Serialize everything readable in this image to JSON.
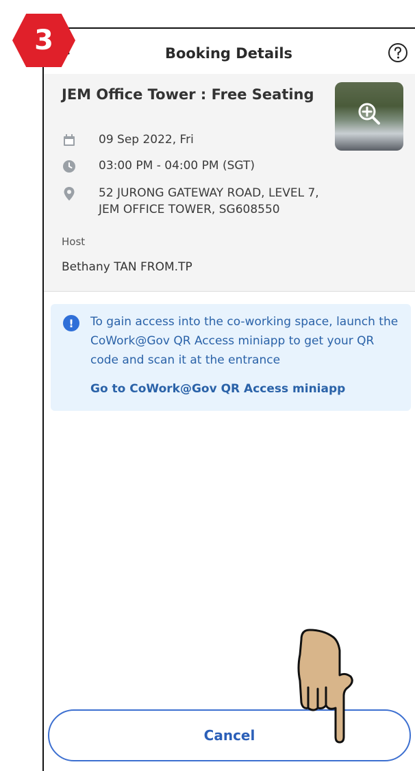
{
  "tutorial": {
    "step_number": "3"
  },
  "header": {
    "title": "Booking Details"
  },
  "details": {
    "venue_title": "JEM Office Tower : Free Seating",
    "date": "09 Sep 2022, Fri",
    "time": "03:00 PM - 04:00 PM (SGT)",
    "address": "52 JURONG GATEWAY ROAD, LEVEL 7, JEM OFFICE TOWER, SG608550",
    "host_label": "Host",
    "host_name": "Bethany TAN FROM.TP"
  },
  "notice": {
    "text": "To gain access into the co-working space, launch the CoWork@Gov QR Access miniapp to get your QR code and scan it at the entrance",
    "link_label": "Go to CoWork@Gov QR Access miniapp"
  },
  "actions": {
    "cancel_label": "Cancel"
  },
  "colors": {
    "accent_blue": "#2a62a8",
    "badge_red": "#e0202a",
    "notice_bg": "#e8f3fd",
    "card_bg": "#f4f4f4"
  },
  "icons": [
    "back-arrow-icon",
    "help-icon",
    "calendar-icon",
    "clock-icon",
    "location-pin-icon",
    "zoom-icon",
    "info-icon",
    "hand-pointer-icon"
  ]
}
